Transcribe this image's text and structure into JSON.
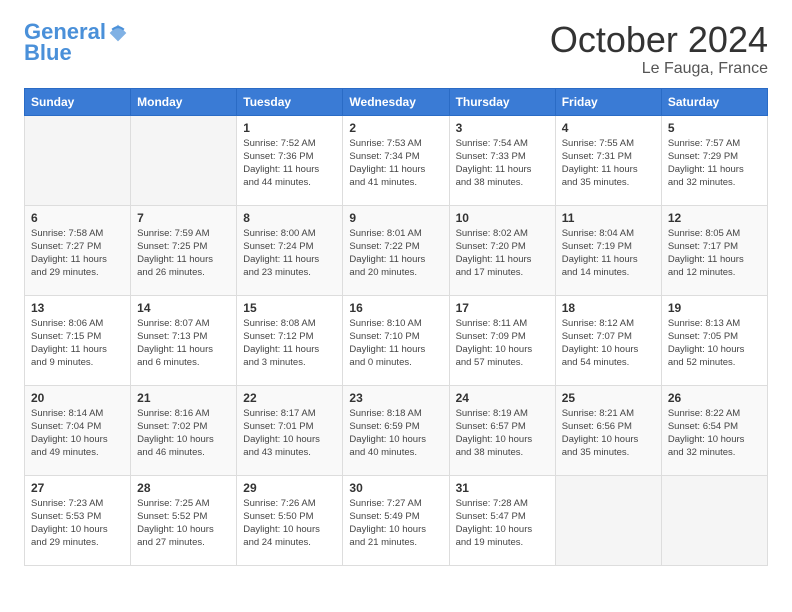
{
  "logo": {
    "line1": "General",
    "line2": "Blue"
  },
  "title": "October 2024",
  "subtitle": "Le Fauga, France",
  "days_header": [
    "Sunday",
    "Monday",
    "Tuesday",
    "Wednesday",
    "Thursday",
    "Friday",
    "Saturday"
  ],
  "weeks": [
    [
      {
        "day": "",
        "info": ""
      },
      {
        "day": "",
        "info": ""
      },
      {
        "day": "1",
        "info": "Sunrise: 7:52 AM\nSunset: 7:36 PM\nDaylight: 11 hours\nand 44 minutes."
      },
      {
        "day": "2",
        "info": "Sunrise: 7:53 AM\nSunset: 7:34 PM\nDaylight: 11 hours\nand 41 minutes."
      },
      {
        "day": "3",
        "info": "Sunrise: 7:54 AM\nSunset: 7:33 PM\nDaylight: 11 hours\nand 38 minutes."
      },
      {
        "day": "4",
        "info": "Sunrise: 7:55 AM\nSunset: 7:31 PM\nDaylight: 11 hours\nand 35 minutes."
      },
      {
        "day": "5",
        "info": "Sunrise: 7:57 AM\nSunset: 7:29 PM\nDaylight: 11 hours\nand 32 minutes."
      }
    ],
    [
      {
        "day": "6",
        "info": "Sunrise: 7:58 AM\nSunset: 7:27 PM\nDaylight: 11 hours\nand 29 minutes."
      },
      {
        "day": "7",
        "info": "Sunrise: 7:59 AM\nSunset: 7:25 PM\nDaylight: 11 hours\nand 26 minutes."
      },
      {
        "day": "8",
        "info": "Sunrise: 8:00 AM\nSunset: 7:24 PM\nDaylight: 11 hours\nand 23 minutes."
      },
      {
        "day": "9",
        "info": "Sunrise: 8:01 AM\nSunset: 7:22 PM\nDaylight: 11 hours\nand 20 minutes."
      },
      {
        "day": "10",
        "info": "Sunrise: 8:02 AM\nSunset: 7:20 PM\nDaylight: 11 hours\nand 17 minutes."
      },
      {
        "day": "11",
        "info": "Sunrise: 8:04 AM\nSunset: 7:19 PM\nDaylight: 11 hours\nand 14 minutes."
      },
      {
        "day": "12",
        "info": "Sunrise: 8:05 AM\nSunset: 7:17 PM\nDaylight: 11 hours\nand 12 minutes."
      }
    ],
    [
      {
        "day": "13",
        "info": "Sunrise: 8:06 AM\nSunset: 7:15 PM\nDaylight: 11 hours\nand 9 minutes."
      },
      {
        "day": "14",
        "info": "Sunrise: 8:07 AM\nSunset: 7:13 PM\nDaylight: 11 hours\nand 6 minutes."
      },
      {
        "day": "15",
        "info": "Sunrise: 8:08 AM\nSunset: 7:12 PM\nDaylight: 11 hours\nand 3 minutes."
      },
      {
        "day": "16",
        "info": "Sunrise: 8:10 AM\nSunset: 7:10 PM\nDaylight: 11 hours\nand 0 minutes."
      },
      {
        "day": "17",
        "info": "Sunrise: 8:11 AM\nSunset: 7:09 PM\nDaylight: 10 hours\nand 57 minutes."
      },
      {
        "day": "18",
        "info": "Sunrise: 8:12 AM\nSunset: 7:07 PM\nDaylight: 10 hours\nand 54 minutes."
      },
      {
        "day": "19",
        "info": "Sunrise: 8:13 AM\nSunset: 7:05 PM\nDaylight: 10 hours\nand 52 minutes."
      }
    ],
    [
      {
        "day": "20",
        "info": "Sunrise: 8:14 AM\nSunset: 7:04 PM\nDaylight: 10 hours\nand 49 minutes."
      },
      {
        "day": "21",
        "info": "Sunrise: 8:16 AM\nSunset: 7:02 PM\nDaylight: 10 hours\nand 46 minutes."
      },
      {
        "day": "22",
        "info": "Sunrise: 8:17 AM\nSunset: 7:01 PM\nDaylight: 10 hours\nand 43 minutes."
      },
      {
        "day": "23",
        "info": "Sunrise: 8:18 AM\nSunset: 6:59 PM\nDaylight: 10 hours\nand 40 minutes."
      },
      {
        "day": "24",
        "info": "Sunrise: 8:19 AM\nSunset: 6:57 PM\nDaylight: 10 hours\nand 38 minutes."
      },
      {
        "day": "25",
        "info": "Sunrise: 8:21 AM\nSunset: 6:56 PM\nDaylight: 10 hours\nand 35 minutes."
      },
      {
        "day": "26",
        "info": "Sunrise: 8:22 AM\nSunset: 6:54 PM\nDaylight: 10 hours\nand 32 minutes."
      }
    ],
    [
      {
        "day": "27",
        "info": "Sunrise: 7:23 AM\nSunset: 5:53 PM\nDaylight: 10 hours\nand 29 minutes."
      },
      {
        "day": "28",
        "info": "Sunrise: 7:25 AM\nSunset: 5:52 PM\nDaylight: 10 hours\nand 27 minutes."
      },
      {
        "day": "29",
        "info": "Sunrise: 7:26 AM\nSunset: 5:50 PM\nDaylight: 10 hours\nand 24 minutes."
      },
      {
        "day": "30",
        "info": "Sunrise: 7:27 AM\nSunset: 5:49 PM\nDaylight: 10 hours\nand 21 minutes."
      },
      {
        "day": "31",
        "info": "Sunrise: 7:28 AM\nSunset: 5:47 PM\nDaylight: 10 hours\nand 19 minutes."
      },
      {
        "day": "",
        "info": ""
      },
      {
        "day": "",
        "info": ""
      }
    ]
  ]
}
